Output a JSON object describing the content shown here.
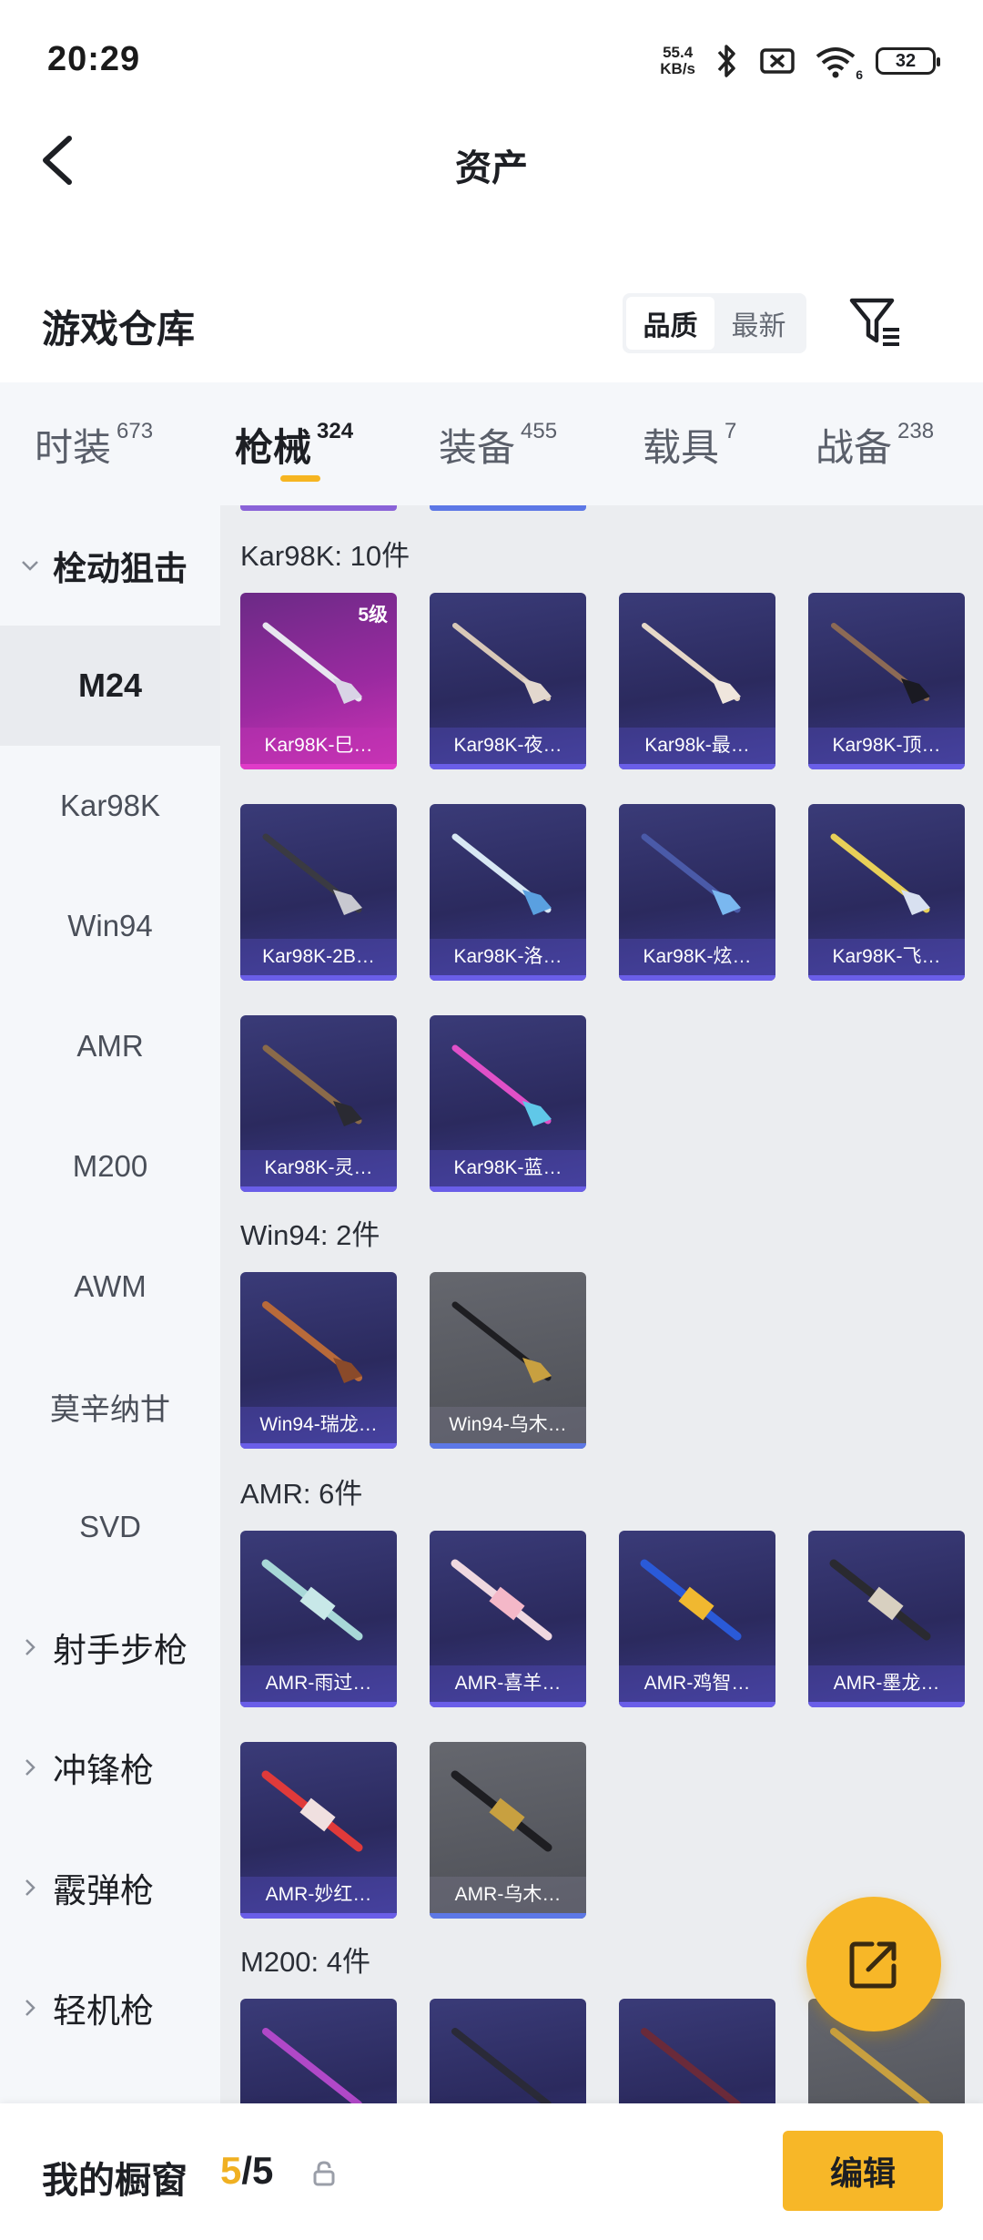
{
  "status_bar": {
    "time": "20:29",
    "net_speed_value": "55.4",
    "net_speed_unit": "KB/s",
    "wifi_level": "6",
    "battery": "32"
  },
  "header": {
    "title": "资产"
  },
  "section": {
    "title": "游戏仓库",
    "sort_options": [
      "品质",
      "最新"
    ],
    "active_sort": "品质"
  },
  "tabs": [
    {
      "label": "时装",
      "count": "673"
    },
    {
      "label": "枪械",
      "count": "324"
    },
    {
      "label": "装备",
      "count": "455"
    },
    {
      "label": "载具",
      "count": "7"
    },
    {
      "label": "战备",
      "count": "238"
    }
  ],
  "active_tab": "枪械",
  "sidebar": {
    "group_open": "栓动狙击",
    "items": [
      "M24",
      "Kar98K",
      "Win94",
      "AMR",
      "M200",
      "AWM",
      "莫辛纳甘",
      "SVD"
    ],
    "active_item": "M24",
    "groups_collapsed": [
      "射手步枪",
      "冲锋枪",
      "霰弹枪",
      "轻机枪"
    ]
  },
  "groups": [
    {
      "title": "Kar98K: 10件",
      "items": [
        "Kar98K-巳…",
        "Kar98K-夜…",
        "Kar98k-最…",
        "Kar98K-顶…",
        "Kar98K-2B…",
        "Kar98K-洛…",
        "Kar98K-炫…",
        "Kar98K-飞…",
        "Kar98K-灵…",
        "Kar98K-蓝…"
      ]
    },
    {
      "title": "Win94: 2件",
      "items": [
        "Win94-瑞龙…",
        "Win94-乌木…"
      ]
    },
    {
      "title": "AMR: 6件",
      "items": [
        "AMR-雨过…",
        "AMR-喜羊…",
        "AMR-鸡智…",
        "AMR-墨龙…",
        "AMR-妙红…",
        "AMR-乌木…"
      ]
    },
    {
      "title": "M200: 4件",
      "items": []
    }
  ],
  "card_badge": "5级",
  "bottom": {
    "label": "我的橱窗",
    "current": "5",
    "separator": "/",
    "total": "5",
    "edit_label": "编辑"
  },
  "colors": {
    "accent": "#f7b728",
    "card_purple": "#2b2a5e",
    "card_pink": "#9a2aa0",
    "card_gray": "#4d4f56"
  },
  "icons": [
    "back-arrow-icon",
    "filter-icon",
    "share-icon",
    "lock-icon",
    "bluetooth-icon",
    "sim-off-icon",
    "wifi-icon",
    "chevron-down-icon",
    "chevron-right-icon"
  ]
}
